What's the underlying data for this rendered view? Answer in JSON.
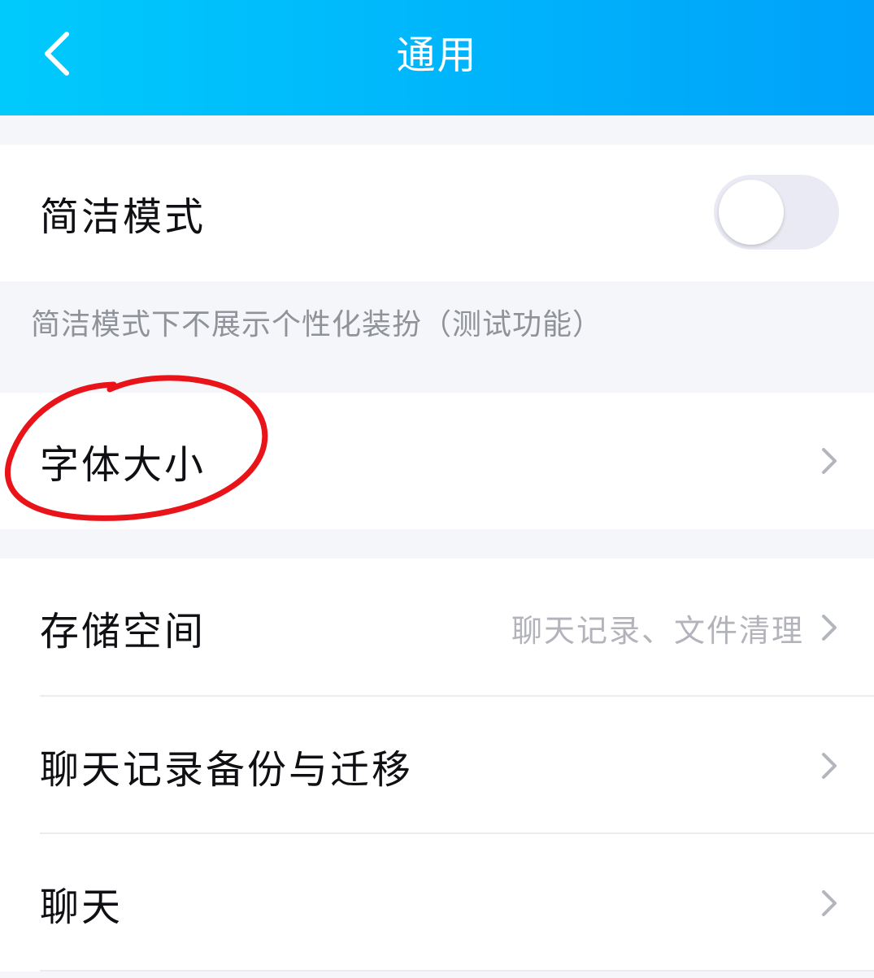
{
  "header": {
    "title": "通用",
    "back_icon": "chevron-left-icon"
  },
  "colors": {
    "header_gradient_start": "#00cafc",
    "header_gradient_end": "#00a2fa",
    "annotation_circle": "#e8141a"
  },
  "sections": {
    "simple_mode": {
      "label": "简洁模式",
      "toggle_on": false,
      "note": "简洁模式下不展示个性化装扮（测试功能）"
    },
    "font_size": {
      "label": "字体大小"
    },
    "storage": {
      "label": "存储空间",
      "value": "聊天记录、文件清理"
    },
    "chat_backup": {
      "label": "聊天记录备份与迁移"
    },
    "chat": {
      "label": "聊天"
    }
  }
}
